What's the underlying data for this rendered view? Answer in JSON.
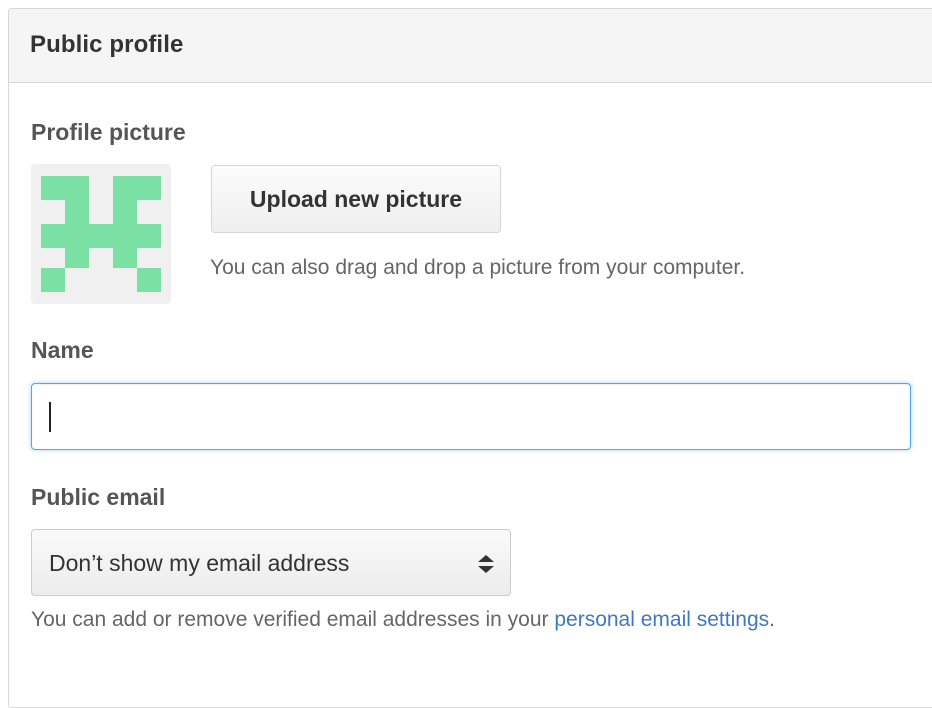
{
  "panel": {
    "title": "Public profile"
  },
  "picture": {
    "label": "Profile picture",
    "upload_button": "Upload new picture",
    "hint": "You can also drag and drop a picture from your computer.",
    "avatar_color": "#7ae0a4"
  },
  "name": {
    "label": "Name",
    "value": ""
  },
  "public_email": {
    "label": "Public email",
    "selected": "Don’t show my email address",
    "hint_prefix": "You can add or remove verified email addresses in your ",
    "hint_link": "personal email settings",
    "hint_suffix": "."
  },
  "colors": {
    "focus": "#51a7e8",
    "link": "#4078c0"
  }
}
